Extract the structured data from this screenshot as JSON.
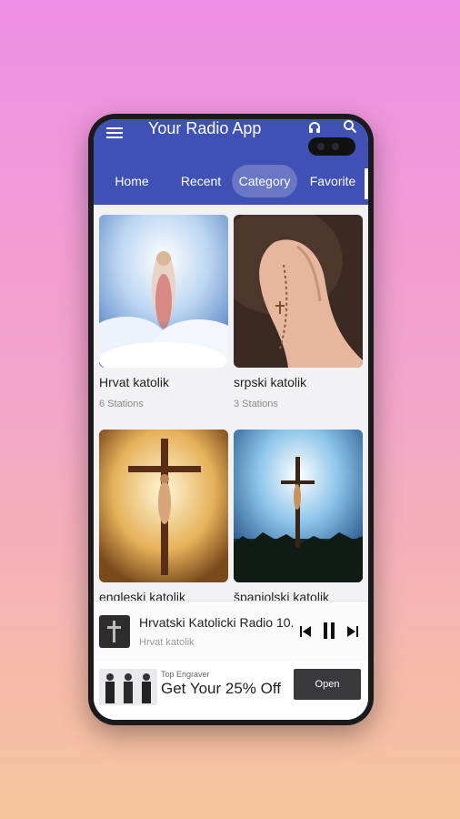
{
  "app": {
    "title": "Your Radio App"
  },
  "tabs": [
    {
      "label": "Home"
    },
    {
      "label": "Recent"
    },
    {
      "label": "Category",
      "active": true
    },
    {
      "label": "Favorite"
    }
  ],
  "categories": [
    {
      "name": "Hrvat katolik",
      "count": "6 Stations",
      "image": "jesus-clouds"
    },
    {
      "name": "srpski katolik",
      "count": "3 Stations",
      "image": "praying-hands-rosary"
    },
    {
      "name": "engleski katolik",
      "count": "",
      "image": "crucifix-golden-light"
    },
    {
      "name": "španjolski katolik",
      "count": "",
      "image": "crucifix-blue-sky"
    }
  ],
  "now_playing": {
    "title": "Hrvatski Katolicki Radio 10...",
    "subtitle": "Hrvat katolik"
  },
  "ad": {
    "brand": "Top Engraver",
    "headline": "Get Your 25% Off",
    "button": "Open"
  },
  "colors": {
    "appbar": "#3f51b5",
    "background_top": "#ef8fe6",
    "background_bottom": "#f7c59a"
  }
}
